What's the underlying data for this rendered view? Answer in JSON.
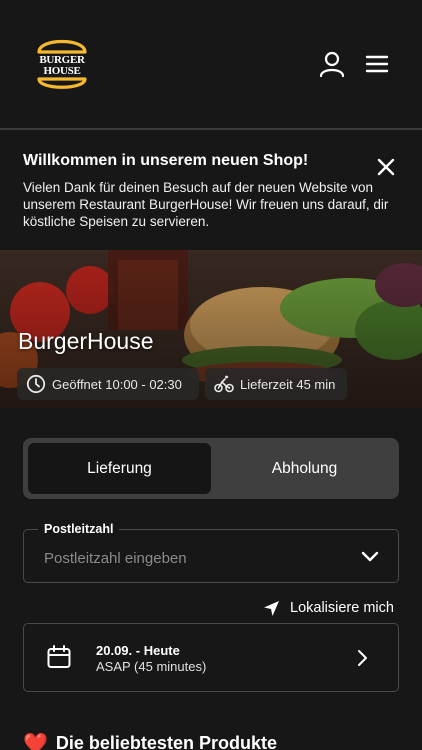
{
  "header": {
    "logo": {
      "line1": "BURGER",
      "line2": "HOUSE"
    },
    "icons": {
      "account": "user-icon",
      "menu": "hamburger-menu-icon"
    }
  },
  "notice": {
    "title": "Willkommen in unserem neuen Shop!",
    "body": "Vielen Dank für deinen Besuch auf der neuen Website von unserem Restaurant BurgerHouse! Wir freuen uns darauf, dir köstliche Speisen zu servieren.",
    "close_icon": "close-icon"
  },
  "hero": {
    "restaurant_name": "BurgerHouse",
    "opening_hours": "Geöffnet 10:00 - 02:30",
    "delivery_time": "Lieferzeit 45 min"
  },
  "order_mode": {
    "options": [
      "Lieferung",
      "Abholung"
    ],
    "selected": "Lieferung"
  },
  "postcode": {
    "label": "Postleitzahl",
    "placeholder": "Postleitzahl eingeben",
    "value": ""
  },
  "locate": {
    "label": "Lokalisiere mich"
  },
  "schedule": {
    "date": "20.09. - Heute",
    "time": "ASAP (45 minutes)"
  },
  "popular": {
    "title": "Die beliebtesten Produkte",
    "emoji": "❤️"
  },
  "colors": {
    "background": "#171717",
    "toggle_track": "#3f3f3f",
    "toggle_active": "#151515",
    "logo_yellow": "#f5b82e",
    "heart_red": "#e0303a"
  }
}
